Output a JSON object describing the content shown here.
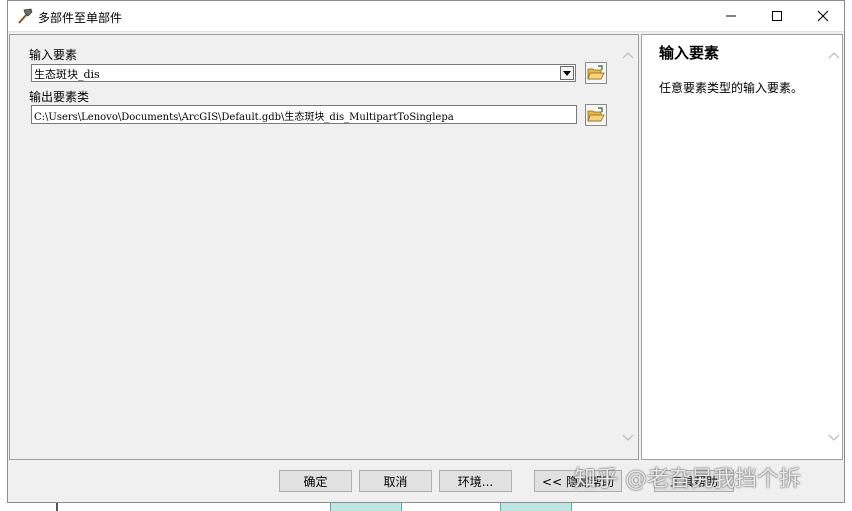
{
  "window": {
    "title": "多部件至单部件",
    "controls": {
      "minimize": "—",
      "maximize": "☐",
      "close": "✕"
    }
  },
  "form": {
    "input_label": "输入要素",
    "input_value": "生态斑块_dis",
    "output_label": "输出要素类",
    "output_value": "C:\\Users\\Lenovo\\Documents\\ArcGIS\\Default.gdb\\生态斑块_dis_MultipartToSinglepa"
  },
  "help": {
    "title": "输入要素",
    "text": "任意要素类型的输入要素。"
  },
  "buttons": {
    "ok": "确定",
    "cancel": "取消",
    "environments": "环境...",
    "hide_help": "<< 隐藏帮助",
    "tool_help": "工具帮助"
  },
  "watermark": "知乎 @老旮旯我挡个拆",
  "icons": [
    "hammer-icon",
    "folder-open-icon",
    "dropdown-arrow-icon",
    "scroll-up-icon",
    "scroll-down-icon"
  ]
}
